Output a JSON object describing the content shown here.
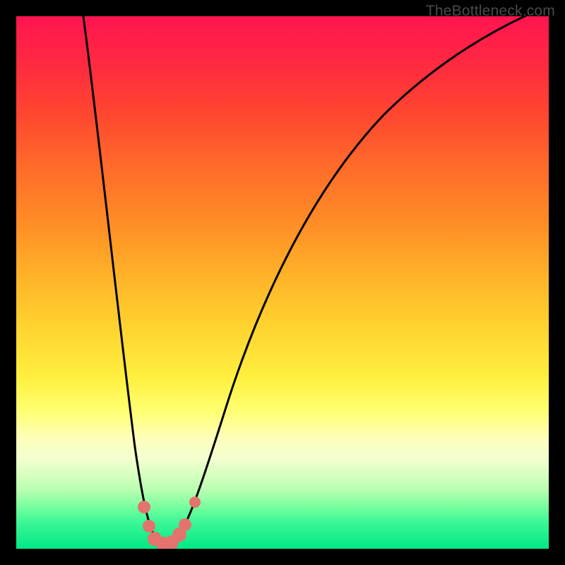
{
  "watermark": "TheBottleneck.com",
  "chart_data": {
    "type": "line",
    "title": "",
    "xlabel": "",
    "ylabel": "",
    "xlim": [
      0,
      100
    ],
    "ylim": [
      0,
      100
    ],
    "grid": false,
    "legend": false,
    "notes": "Axes are unlabeled in the source image; values below are normalized 0–100 estimates read from pixel positions. The background vertical gradient runs red (top / high y) → green (bottom / low y). The single black curve forms a sharp V with its minimum near x≈28; red/salmon marker dots sit on the curve near the trough.",
    "series": [
      {
        "name": "curve",
        "x": [
          12,
          14,
          16,
          18,
          20,
          22,
          24,
          26,
          28,
          30,
          33,
          37,
          42,
          50,
          60,
          70,
          80,
          90,
          100
        ],
        "y": [
          100,
          85,
          70,
          55,
          40,
          28,
          16,
          7,
          1,
          4,
          12,
          26,
          42,
          60,
          74,
          84,
          92,
          97,
          102
        ]
      }
    ],
    "markers": {
      "name": "trough-dots",
      "color": "#e4736e",
      "x": [
        24,
        25,
        26,
        27.5,
        29,
        30.5,
        31.5,
        33.5
      ],
      "y": [
        8,
        5,
        2.5,
        1.5,
        1.8,
        3,
        5,
        9
      ]
    },
    "background_gradient_stops": [
      {
        "pos": 0.0,
        "color": "#ff1450"
      },
      {
        "pos": 0.28,
        "color": "#ff6a2a"
      },
      {
        "pos": 0.58,
        "color": "#ffd22e"
      },
      {
        "pos": 0.74,
        "color": "#ffff70"
      },
      {
        "pos": 0.86,
        "color": "#d8ffc0"
      },
      {
        "pos": 1.0,
        "color": "#00e886"
      }
    ]
  }
}
